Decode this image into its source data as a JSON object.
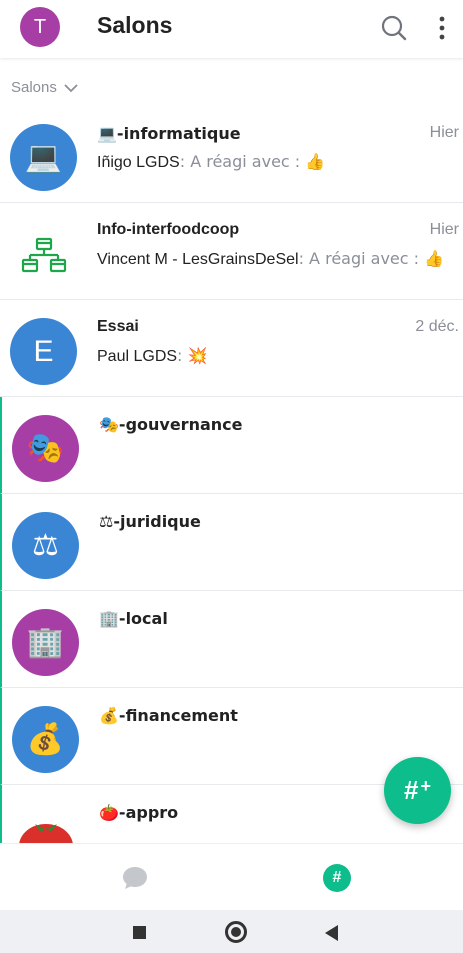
{
  "appbar": {
    "avatar_letter": "T",
    "title": "Salons"
  },
  "section": {
    "label": "Salons"
  },
  "rooms": [
    {
      "name": "💻-informatique",
      "time": "Hier",
      "sender": "Iñigo LGDS",
      "message": ": A réagi avec : 👍",
      "avatar": "💻",
      "avatar_color": "#3a86d4"
    },
    {
      "name": "Info-interfoodcoop",
      "time": "Hier",
      "sender": "Vincent M - LesGrainsDeSel",
      "message": ": A réagi avec : 👍",
      "avatar": "network-stores-icon",
      "avatar_color": "#ffffff"
    },
    {
      "name": "Essai",
      "time": "2 déc.",
      "sender": "Paul LGDS",
      "message": ": 💥",
      "avatar": "E",
      "avatar_color": "#3a86d4"
    },
    {
      "name": "🎭-gouvernance",
      "time": "",
      "sender": "",
      "message": "",
      "avatar": "🎭",
      "avatar_color": "#a63ea5"
    },
    {
      "name": "⚖-juridique",
      "time": "",
      "sender": "",
      "message": "",
      "avatar": "⚖",
      "avatar_color": "#3a86d4"
    },
    {
      "name": "🏢-local",
      "time": "",
      "sender": "",
      "message": "",
      "avatar": "🏢",
      "avatar_color": "#a63ea5"
    },
    {
      "name": "💰-financement",
      "time": "",
      "sender": "",
      "message": "",
      "avatar": "💰",
      "avatar_color": "#3a86d4"
    },
    {
      "name": "🍅-appro",
      "time": "",
      "sender": "",
      "message": "",
      "avatar": "🍅",
      "avatar_color": "#ffffff"
    }
  ],
  "fab": {
    "label": "#",
    "plus": "+"
  },
  "bottomnav": {
    "rooms_label": "#"
  },
  "colors": {
    "accent": "#0dbd8b",
    "muted": "#8a8f98"
  }
}
